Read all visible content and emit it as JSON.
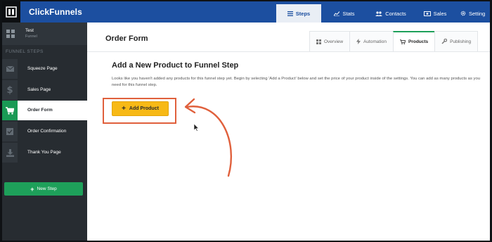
{
  "app": {
    "brand": "ClickFunnels"
  },
  "topnav": {
    "items": [
      {
        "label": "Steps",
        "icon": "list-icon",
        "active": true
      },
      {
        "label": "Stats",
        "icon": "chart-icon",
        "active": false
      },
      {
        "label": "Contacts",
        "icon": "users-icon",
        "active": false
      },
      {
        "label": "Sales",
        "icon": "money-icon",
        "active": false
      },
      {
        "label": "Setting",
        "icon": "gear-icon",
        "active": false
      }
    ]
  },
  "sidebar": {
    "funnel_name": "Test",
    "funnel_sub": "Funnel",
    "section_label": "FUNNEL STEPS",
    "steps": [
      {
        "label": "Squeeze Page",
        "icon": "envelope-icon",
        "active": false
      },
      {
        "label": "Sales Page",
        "icon": "dollar-icon",
        "active": false
      },
      {
        "label": "Order Form",
        "icon": "cart-icon",
        "active": true
      },
      {
        "label": "Order Confirmation",
        "icon": "checkbox-icon",
        "active": false
      },
      {
        "label": "Thank You Page",
        "icon": "download-icon",
        "active": false
      }
    ],
    "new_step_label": "New Step"
  },
  "main": {
    "page_title": "Order Form",
    "tabs": [
      {
        "label": "Overview",
        "icon": "grid-icon",
        "active": false
      },
      {
        "label": "Automation",
        "icon": "bolt-icon",
        "active": false
      },
      {
        "label": "Products",
        "icon": "cart-icon",
        "active": true
      },
      {
        "label": "Publishing",
        "icon": "wrench-icon",
        "active": false
      }
    ],
    "section_title": "Add a New Product to Funnel Step",
    "description": "Looks like you haven't added any products for this funnel step yet. Begin by selecting 'Add a Product' below and set the price of your product inside of the settings. You can add as many products as you need for this funnel step.",
    "add_product_label": "Add Product"
  },
  "colors": {
    "topbar": "#1c4fa0",
    "sidebar": "#272c31",
    "accent_green": "#1ea05a",
    "button_yellow": "#f7b916",
    "annotation_orange": "#e0603c"
  }
}
